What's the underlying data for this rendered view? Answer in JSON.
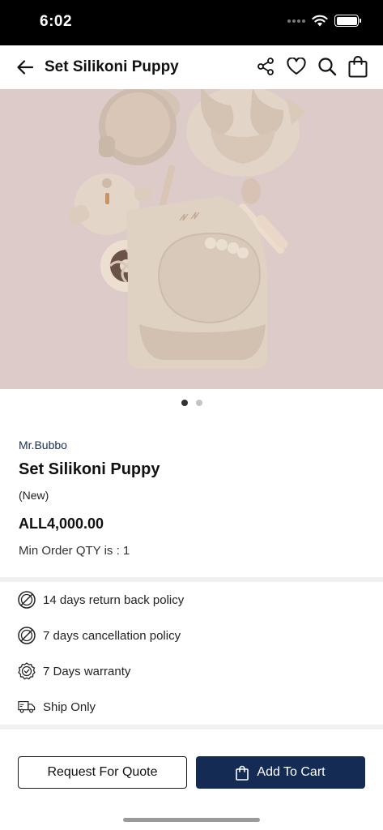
{
  "status_bar": {
    "time": "6:02"
  },
  "nav": {
    "title": "Set Silikoni Puppy"
  },
  "carousel": {
    "total": 2,
    "active_index": 1
  },
  "product": {
    "brand": "Mr.Bubbo",
    "title": "Set Silikoni Puppy",
    "condition": "(New)",
    "price": "ALL4,000.00",
    "min_order": "Min Order QTY is : 1"
  },
  "policies": [
    {
      "icon": "no-return-icon",
      "label": "14 days return back policy"
    },
    {
      "icon": "no-cancel-icon",
      "label": "7 days cancellation policy"
    },
    {
      "icon": "warranty-badge-icon",
      "label": "7 Days warranty"
    },
    {
      "icon": "truck-icon",
      "label": "Ship Only"
    }
  ],
  "actions": {
    "quote_label": "Request For Quote",
    "cart_label": "Add To Cart"
  },
  "colors": {
    "primary": "#142c54",
    "brand_text": "#1b2f55",
    "image_bg": "#dbc9c7"
  }
}
